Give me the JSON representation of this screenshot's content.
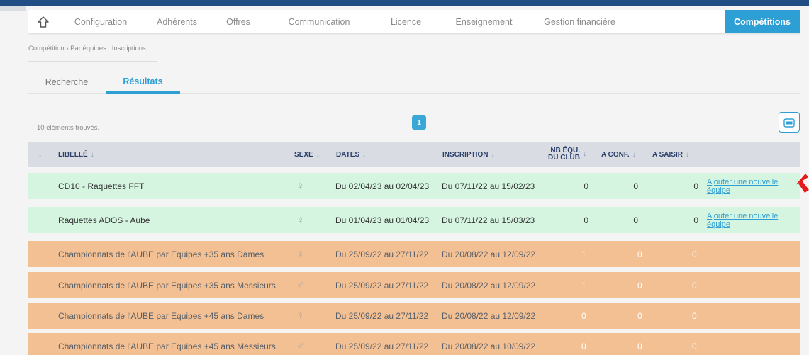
{
  "nav": {
    "home_icon": "home-icon",
    "items": [
      "Configuration",
      "Adhérents",
      "Offres",
      "Communication",
      "Licence",
      "Enseignement",
      "Gestion financière",
      "Compétitions"
    ],
    "active": "Compétitions",
    "accent": "#2e9fd4"
  },
  "breadcrumb": "Compétition  › Par équipes : Inscriptions",
  "tabs": {
    "search": "Recherche",
    "results": "Résultats"
  },
  "results_count": "10 éléments trouvés.",
  "pagination": {
    "current": "1"
  },
  "export_icon": "csv-export-icon",
  "table": {
    "headers": {
      "libelle": "LIBELLÉ",
      "sexe": "SEXE",
      "dates": "DATES",
      "inscription": "INSCRIPTION",
      "nb_equ_1": "NB ÉQU.",
      "nb_equ_2": "DU CLUB",
      "a_conf": "A CONF.",
      "a_saisir": "A SAISIR"
    },
    "sort_icon": "↓",
    "rows": [
      {
        "libelle": "CD10 - Raquettes FFT",
        "sexe": "♀",
        "dates": "Du 02/04/23 au 02/04/23",
        "inscription": "Du 07/11/22 au 15/02/23",
        "nb_equ": "0",
        "a_conf": "0",
        "a_saisir": "0",
        "action": "Ajouter une nouvelle équipe",
        "status": "green"
      },
      {
        "libelle": "Raquettes ADOS - Aube",
        "sexe": "♀",
        "dates": "Du 01/04/23 au 01/04/23",
        "inscription": "Du 07/11/22 au 15/03/23",
        "nb_equ": "0",
        "a_conf": "0",
        "a_saisir": "0",
        "action": "Ajouter une nouvelle équipe",
        "status": "green"
      },
      {
        "libelle": "Championnats de l'AUBE par Equipes +35 ans Dames",
        "sexe": "♀",
        "dates": "Du 25/09/22 au 27/11/22",
        "inscription": "Du 20/08/22 au 12/09/22",
        "nb_equ": "1",
        "a_conf": "0",
        "a_saisir": "0",
        "action": "",
        "status": "orange"
      },
      {
        "libelle": "Championnats de l'AUBE par Equipes +35 ans Messieurs",
        "sexe": "♂",
        "dates": "Du 25/09/22 au 27/11/22",
        "inscription": "Du 20/08/22 au 12/09/22",
        "nb_equ": "1",
        "a_conf": "0",
        "a_saisir": "0",
        "action": "",
        "status": "orange"
      },
      {
        "libelle": "Championnats de l'AUBE par Equipes +45 ans Dames",
        "sexe": "♀",
        "dates": "Du 25/09/22 au 27/11/22",
        "inscription": "Du 20/08/22 au 12/09/22",
        "nb_equ": "0",
        "a_conf": "0",
        "a_saisir": "0",
        "action": "",
        "status": "orange"
      },
      {
        "libelle": "Championnats de l'AUBE par Equipes +45 ans Messieurs",
        "sexe": "♂",
        "dates": "Du 25/09/22 au 27/11/22",
        "inscription": "Du 20/08/22 au 10/09/22",
        "nb_equ": "0",
        "a_conf": "0",
        "a_saisir": "0",
        "action": "",
        "status": "orange"
      }
    ]
  },
  "colors": {
    "green_row": "#d6f5e1",
    "orange_row": "#f3c093",
    "header": "#d9dde3",
    "annotation_arrow": "#e31b1b"
  }
}
